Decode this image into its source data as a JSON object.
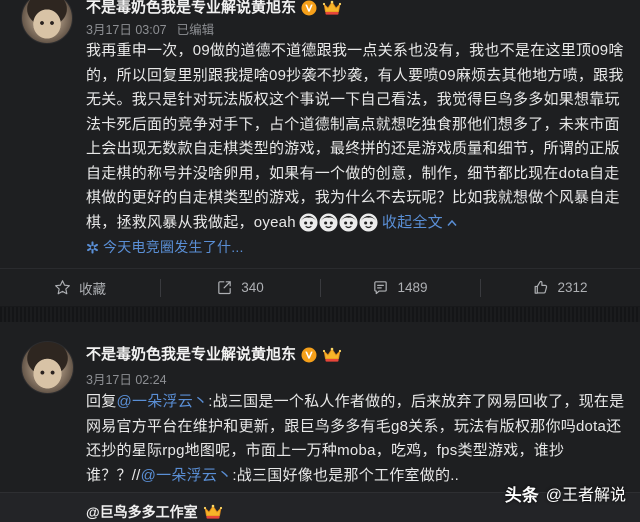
{
  "colors": {
    "background": "#1e1f21",
    "text": "#e8e8e8",
    "link": "#5a8fd6",
    "meta": "#8d8f93",
    "verified": "#f6a01a"
  },
  "post1": {
    "author": {
      "name": "不是毒奶色我是专业解说黄旭东",
      "badges": [
        "verified-v-icon",
        "crown-member-icon"
      ]
    },
    "time": "3月17日 03:07",
    "edited": "已编辑",
    "body_lines": [
      "我再重申一次，09做的道德不道德跟我一点关系也没有，我也不是在这里顶09啥",
      "的，所以回复里别跟我提啥09抄袭不抄袭，有人要喷09麻烦去其他地方喷，跟我",
      "无关。我只是针对玩法版权这个事说一下自己看法，我觉得巨鸟多多如果想靠玩",
      "法卡死后面的竞争对手下，占个道德制高点就想吃独食那他们想多了，未来市面",
      "上会出现无数款自走棋类型的游戏，最终拼的还是游戏质量和细节，所谓的正版",
      "自走棋的称号并没啥卵用，如果有一个做的创意，制作，细节都比现在dota自走",
      "棋做的更好的自走棋类型的游戏，我为什么不去玩呢？比如我就想做个风暴自走"
    ],
    "last_line": "棋，拯救风暴从我做起，oyeah",
    "emojis": [
      "emoji-face-icon",
      "emoji-face-icon",
      "emoji-face-icon",
      "emoji-face-icon"
    ],
    "collapse_link": "收起全文",
    "topic": {
      "icon": "topic-icon",
      "text": "今天电竞圈发生了什..."
    },
    "actions": [
      {
        "icon": "star-icon",
        "label": "收藏"
      },
      {
        "icon": "repost-icon",
        "label": "340"
      },
      {
        "icon": "comment-icon",
        "label": "1489"
      },
      {
        "icon": "like-icon",
        "label": "2312"
      }
    ]
  },
  "post2": {
    "author": {
      "name": "不是毒奶色我是专业解说黄旭东",
      "badges": [
        "verified-v-icon",
        "crown-member-icon"
      ]
    },
    "time": "3月17日 02:24",
    "body_lines": [
      {
        "prefix": "回复",
        "mention": "@一朵浮云丶",
        "text": ":战三国是一个私人作者做的，后来放弃了网易回收了，现在是"
      },
      {
        "text": "网易官方平台在维护和更新，跟巨鸟多多有毛g8关系，玩法有版权那你吗dota还"
      },
      {
        "text": "还抄的星际rpg地图呢，市面上一万种moba，吃鸡，fps类型游戏，谁抄"
      },
      {
        "prefix": "谁？？//",
        "mention": "@一朵浮云丶",
        "text": ":战三国好像也是那个工作室做的.."
      }
    ],
    "quoted": {
      "author": "@巨鸟多多工作室",
      "badge": "crown-member-icon"
    }
  },
  "watermark": {
    "brand": "头条",
    "handle": "@王者解说"
  }
}
